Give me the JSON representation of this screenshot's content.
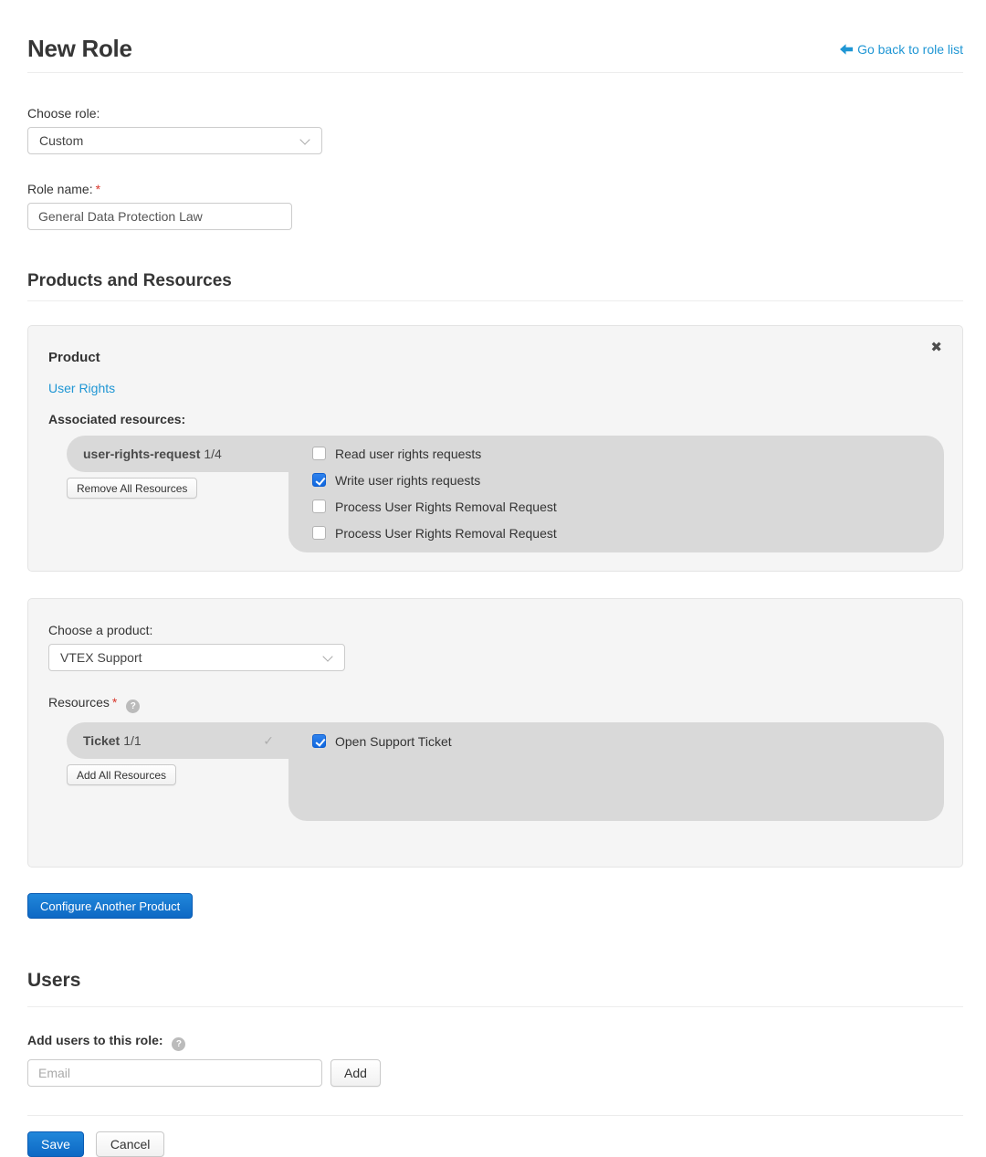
{
  "page": {
    "title": "New Role",
    "back_link_label": "Go back to role list"
  },
  "role_form": {
    "choose_role_label": "Choose role:",
    "choose_role_value": "Custom",
    "role_name_label": "Role name:",
    "role_name_value": "General Data Protection Law"
  },
  "products_section": {
    "heading": "Products and Resources",
    "configured_product": {
      "product_label": "Product",
      "product_name": "User Rights",
      "associated_resources_label": "Associated resources:",
      "resource_tab": {
        "name": "user-rights-request",
        "count": "1/4"
      },
      "remove_all_button": "Remove All Resources",
      "permissions": [
        {
          "label": "Read user rights requests",
          "checked": false
        },
        {
          "label": "Write user rights requests",
          "checked": true
        },
        {
          "label": "Process User Rights Removal Request",
          "checked": false
        },
        {
          "label": "Process User Rights Removal Request",
          "checked": false
        }
      ]
    },
    "new_product": {
      "choose_product_label": "Choose a product:",
      "choose_product_value": "VTEX Support",
      "resources_label": "Resources",
      "resource_tab": {
        "name": "Ticket",
        "count": "1/1"
      },
      "add_all_button": "Add All Resources",
      "permissions": [
        {
          "label": "Open Support Ticket",
          "checked": true
        }
      ]
    },
    "configure_another_button": "Configure Another Product"
  },
  "users_section": {
    "heading": "Users",
    "add_users_label": "Add users to this role:",
    "email_placeholder": "Email",
    "add_button": "Add"
  },
  "footer": {
    "save_button": "Save",
    "cancel_button": "Cancel"
  },
  "icons": {
    "back_arrow": "arrow-left",
    "close_glyph": "✖",
    "help_glyph": "?",
    "tab_check_glyph": "✓",
    "required_marker": "*",
    "select_chevron": "chevron-down"
  },
  "colors": {
    "link_blue": "#1f96d4",
    "primary_button_blue": "#0d68c4",
    "checkbox_checked_blue": "#1068e0",
    "card_background": "#f5f5f5",
    "resource_panel_gray": "#d9d9d9",
    "required_red": "#d9372c"
  }
}
